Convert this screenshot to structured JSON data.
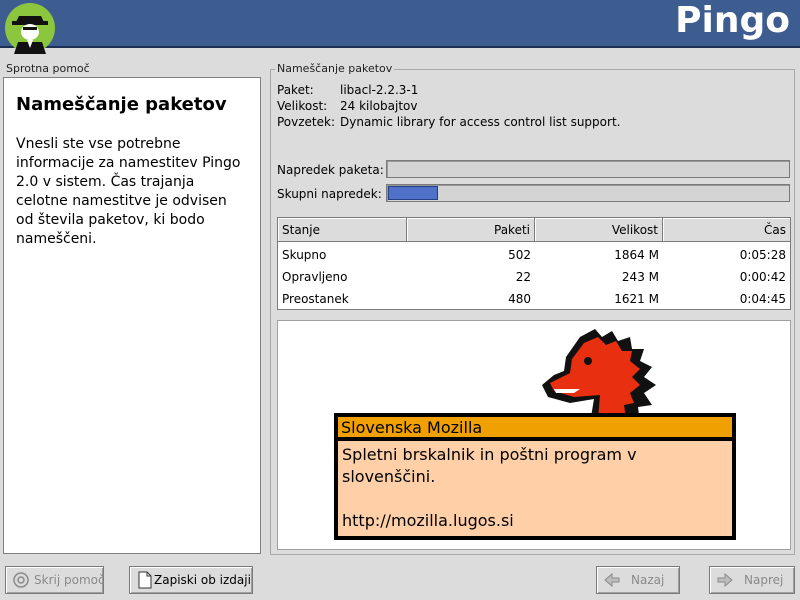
{
  "header": {
    "brand": "Pingo"
  },
  "help": {
    "title": "Sprotna pomoč",
    "heading": "Nameščanje paketov",
    "body": "Vnesli ste vse potrebne informacije za namestitev Pingo 2.0 v sistem. Čas trajanja celotne namestitve je odvisen od števila paketov, ki bodo nameščeni."
  },
  "install": {
    "frame_title": "Nameščanje paketov",
    "package_label": "Paket:",
    "package_value": "libacl-2.2.3-1",
    "size_label": "Velikost:",
    "size_value": "24 kilobajtov",
    "summary_label": "Povzetek:",
    "summary_value": "Dynamic library for access control list support.",
    "package_progress_label": "Napredek paketa:",
    "package_progress": 0.0,
    "total_progress_label": "Skupni napredek:",
    "total_progress": 0.13
  },
  "table": {
    "headers": [
      "Stanje",
      "Paketi",
      "Velikost",
      "Čas"
    ],
    "rows": [
      [
        "Skupno",
        "502",
        "1864 M",
        "0:05:28"
      ],
      [
        "Opravljeno",
        "22",
        "243 M",
        "0:00:42"
      ],
      [
        "Preostanek",
        "480",
        "1621 M",
        "0:04:45"
      ]
    ]
  },
  "ad": {
    "title": "Slovenska Mozilla",
    "line1": "Spletni brskalnik in poštni program v slovenščini.",
    "url": "http://mozilla.lugos.si",
    "colors": {
      "title_bg": "#f0a000",
      "body_bg": "#ffd0a8",
      "dino": "#e83010"
    }
  },
  "buttons": {
    "hide_help": "Skrij pomoč",
    "release_notes": "Zapiski ob izdaji",
    "back": "Nazaj",
    "next": "Naprej"
  }
}
